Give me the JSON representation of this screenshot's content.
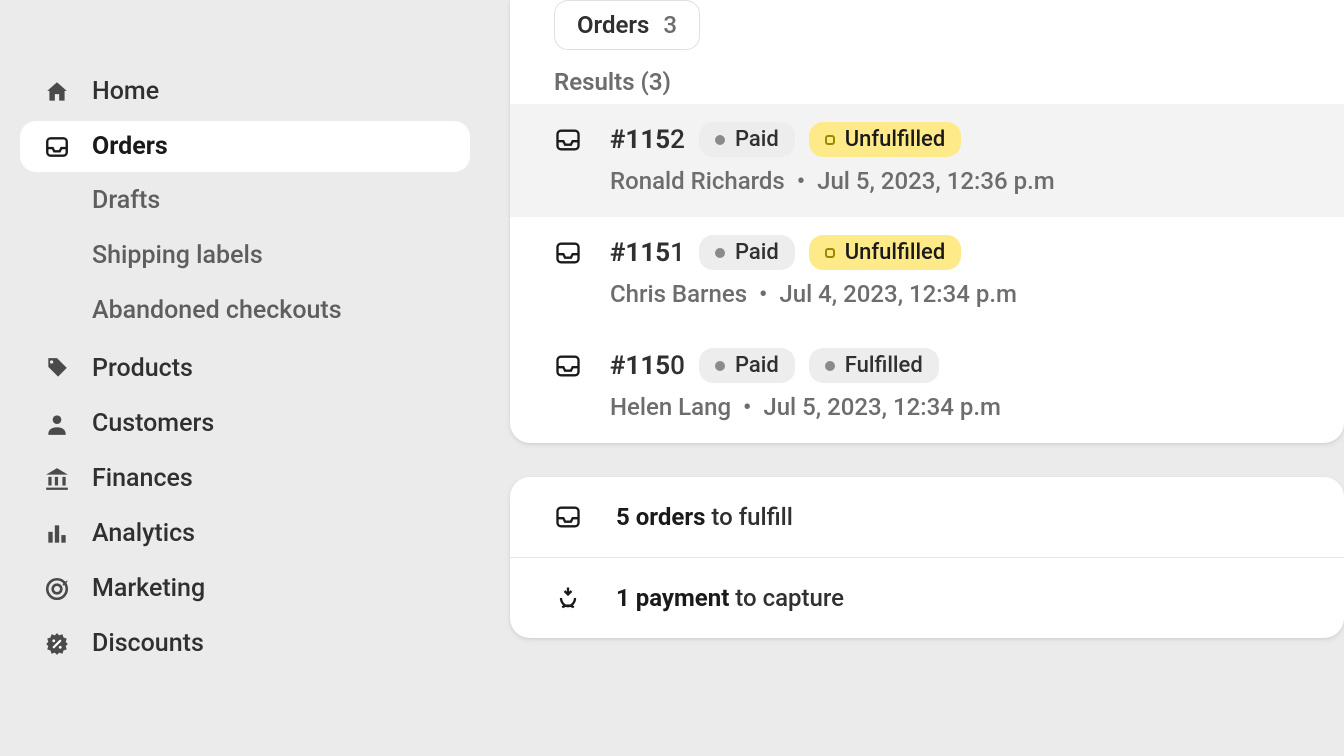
{
  "sidebar": {
    "items": [
      {
        "id": "home",
        "label": "Home"
      },
      {
        "id": "orders",
        "label": "Orders",
        "active": true,
        "sub": [
          {
            "id": "drafts",
            "label": "Drafts"
          },
          {
            "id": "shipping-labels",
            "label": "Shipping labels"
          },
          {
            "id": "abandoned",
            "label": "Abandoned checkouts"
          }
        ]
      },
      {
        "id": "products",
        "label": "Products"
      },
      {
        "id": "customers",
        "label": "Customers"
      },
      {
        "id": "finances",
        "label": "Finances"
      },
      {
        "id": "analytics",
        "label": "Analytics"
      },
      {
        "id": "marketing",
        "label": "Marketing"
      },
      {
        "id": "discounts",
        "label": "Discounts"
      }
    ]
  },
  "results": {
    "tab": {
      "label": "Orders",
      "count": "3"
    },
    "heading": "Results (3)",
    "rows": [
      {
        "order_strong": "#115",
        "order_rest": "2",
        "payment": "Paid",
        "fulfillment": "Unfulfilled",
        "fulfillment_tone": "warning",
        "customer": "Ronald Richards",
        "date": "Jul 5, 2023, 12:36 p.m",
        "selected": true
      },
      {
        "order_strong": "#115",
        "order_rest": "1",
        "payment": "Paid",
        "fulfillment": "Unfulfilled",
        "fulfillment_tone": "warning",
        "customer": "Chris Barnes",
        "date": "Jul 4, 2023, 12:34 p.m",
        "selected": false
      },
      {
        "order_strong": "#115",
        "order_rest": "0",
        "payment": "Paid",
        "fulfillment": "Fulfilled",
        "fulfillment_tone": "neutral",
        "customer": "Helen Lang",
        "date": "Jul 5, 2023, 12:34 p.m",
        "selected": false
      }
    ]
  },
  "summary": {
    "rows": [
      {
        "strong": "5 orders",
        "rest": " to fulfill"
      },
      {
        "strong": "1 payment",
        "rest": " to capture"
      }
    ]
  }
}
